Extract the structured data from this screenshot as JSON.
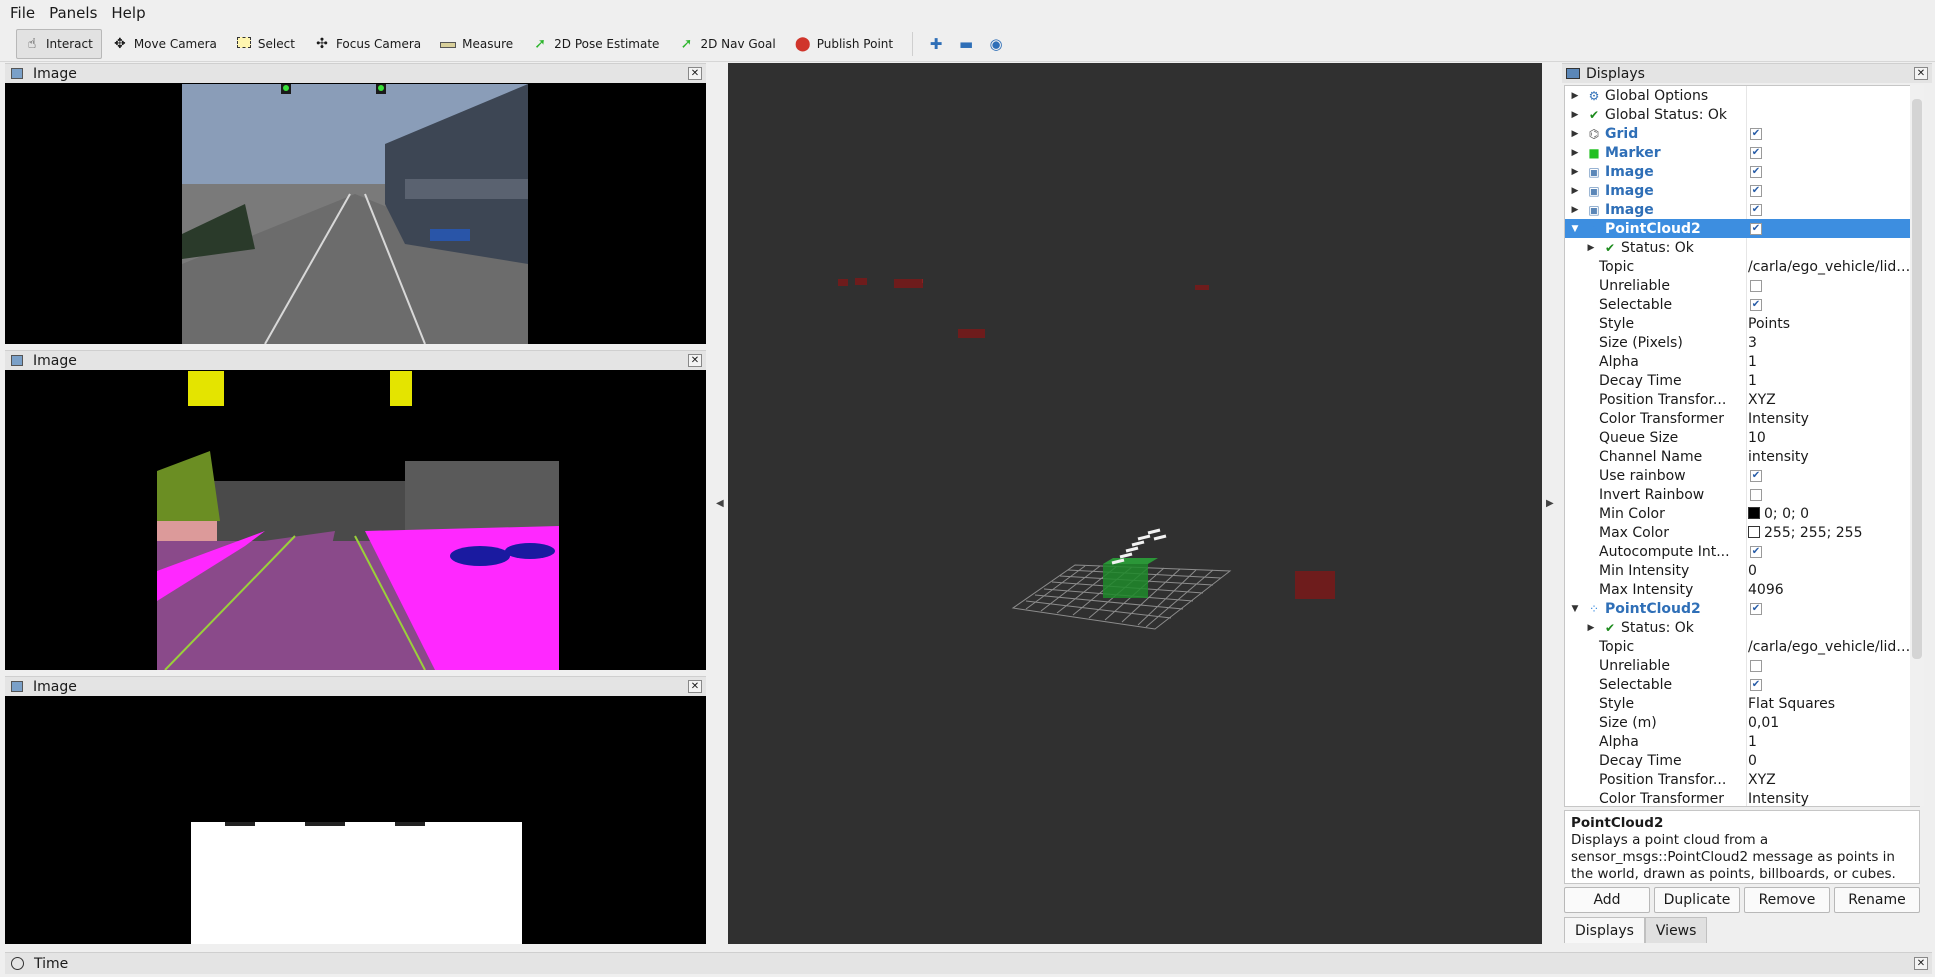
{
  "menu": [
    {
      "label": "File"
    },
    {
      "label": "Panels"
    },
    {
      "label": "Help"
    }
  ],
  "toolbar": {
    "tools": [
      {
        "label": "Interact",
        "icon": "hand-icon",
        "active": true
      },
      {
        "label": "Move Camera",
        "icon": "move-camera-icon"
      },
      {
        "label": "Select",
        "icon": "select-icon"
      },
      {
        "label": "Focus Camera",
        "icon": "focus-camera-icon"
      },
      {
        "label": "Measure",
        "icon": "ruler-icon"
      },
      {
        "label": "2D Pose Estimate",
        "icon": "green-arrow-icon"
      },
      {
        "label": "2D Nav Goal",
        "icon": "green-arrow-icon"
      },
      {
        "label": "Publish Point",
        "icon": "map-pin-icon"
      }
    ]
  },
  "panels": {
    "image1": {
      "title": "Image"
    },
    "image2": {
      "title": "Image"
    },
    "image3": {
      "title": "Image"
    },
    "time": {
      "title": "Time"
    }
  },
  "displays": {
    "title": "Displays",
    "rows": [
      {
        "label": "Global Options"
      },
      {
        "label": "Global Status: Ok"
      },
      {
        "label": "Grid",
        "checked": true
      },
      {
        "label": "Marker",
        "checked": true
      },
      {
        "label": "Image",
        "checked": true
      },
      {
        "label": "Image",
        "checked": true
      },
      {
        "label": "Image",
        "checked": true
      },
      {
        "label": "PointCloud2",
        "checked": true
      },
      {
        "label": "Status: Ok"
      },
      {
        "label": "Topic",
        "value": "/carla/ego_vehicle/lida..."
      },
      {
        "label": "Unreliable",
        "checked": false
      },
      {
        "label": "Selectable",
        "checked": true
      },
      {
        "label": "Style",
        "value": "Points"
      },
      {
        "label": "Size (Pixels)",
        "value": "3"
      },
      {
        "label": "Alpha",
        "value": "1"
      },
      {
        "label": "Decay Time",
        "value": "1"
      },
      {
        "label": "Position Transfor...",
        "value": "XYZ"
      },
      {
        "label": "Color Transformer",
        "value": "Intensity"
      },
      {
        "label": "Queue Size",
        "value": "10"
      },
      {
        "label": "Channel Name",
        "value": "intensity"
      },
      {
        "label": "Use rainbow",
        "checked": true
      },
      {
        "label": "Invert Rainbow",
        "checked": false
      },
      {
        "label": "Min Color",
        "value": "0; 0; 0",
        "swatch": "#000000"
      },
      {
        "label": "Max Color",
        "value": "255; 255; 255",
        "swatch": "#ffffff"
      },
      {
        "label": "Autocompute Int...",
        "checked": true
      },
      {
        "label": "Min Intensity",
        "value": "0"
      },
      {
        "label": "Max Intensity",
        "value": "4096"
      },
      {
        "label": "PointCloud2",
        "checked": true
      },
      {
        "label": "Status: Ok"
      },
      {
        "label": "Topic",
        "value": "/carla/ego_vehicle/lida..."
      },
      {
        "label": "Unreliable",
        "checked": false
      },
      {
        "label": "Selectable",
        "checked": true
      },
      {
        "label": "Style",
        "value": "Flat Squares"
      },
      {
        "label": "Size (m)",
        "value": "0,01"
      },
      {
        "label": "Alpha",
        "value": "1"
      },
      {
        "label": "Decay Time",
        "value": "0"
      },
      {
        "label": "Position Transfor...",
        "value": "XYZ"
      },
      {
        "label": "Color Transformer",
        "value": "Intensity"
      }
    ],
    "description": {
      "title": "PointCloud2",
      "text": "Displays a point cloud from a sensor_msgs::PointCloud2 message as points in the world, drawn as points, billboards, or cubes."
    },
    "buttons": [
      "Add",
      "Duplicate",
      "Remove",
      "Rename"
    ],
    "tabs": [
      "Displays",
      "Views"
    ]
  }
}
